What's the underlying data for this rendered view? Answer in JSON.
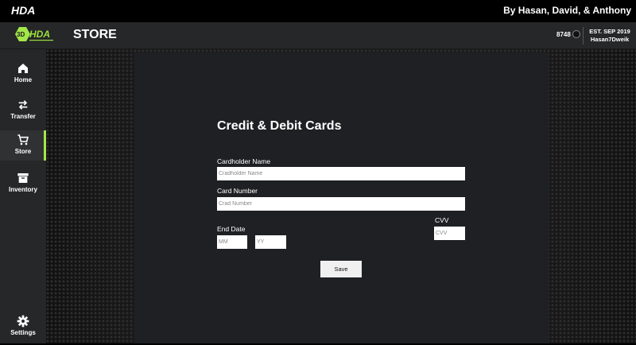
{
  "titlebar": {
    "app_name": "HDA",
    "credits": "By Hasan, David, & Anthony"
  },
  "header": {
    "logo_text": "HDA",
    "logo_prefix": "3D",
    "page_title": "STORE",
    "coins": "8748",
    "est": "EST. SEP 2019",
    "username": "Hasan7Dweik"
  },
  "sidebar": {
    "items": [
      {
        "label": "Home",
        "icon": "home-icon"
      },
      {
        "label": "Transfer",
        "icon": "transfer-icon"
      },
      {
        "label": "Store",
        "icon": "cart-icon",
        "active": true
      },
      {
        "label": "Inventory",
        "icon": "archive-icon"
      },
      {
        "label": "Settings",
        "icon": "gear-icon"
      }
    ]
  },
  "form": {
    "title": "Credit & Debit Cards",
    "cardholder_label": "Cardholder Name",
    "cardholder_placeholder": "Cradholder Name",
    "card_number_label": "Card Number",
    "card_number_placeholder": "Crad Number",
    "end_date_label": "End Date",
    "month_placeholder": "MM",
    "year_placeholder": "YY",
    "cvv_label": "CVV",
    "cvv_placeholder": "CVV",
    "save_label": "Save"
  },
  "colors": {
    "accent": "#a3e64b",
    "background": "#1f2023",
    "sidebar": "#262728"
  }
}
